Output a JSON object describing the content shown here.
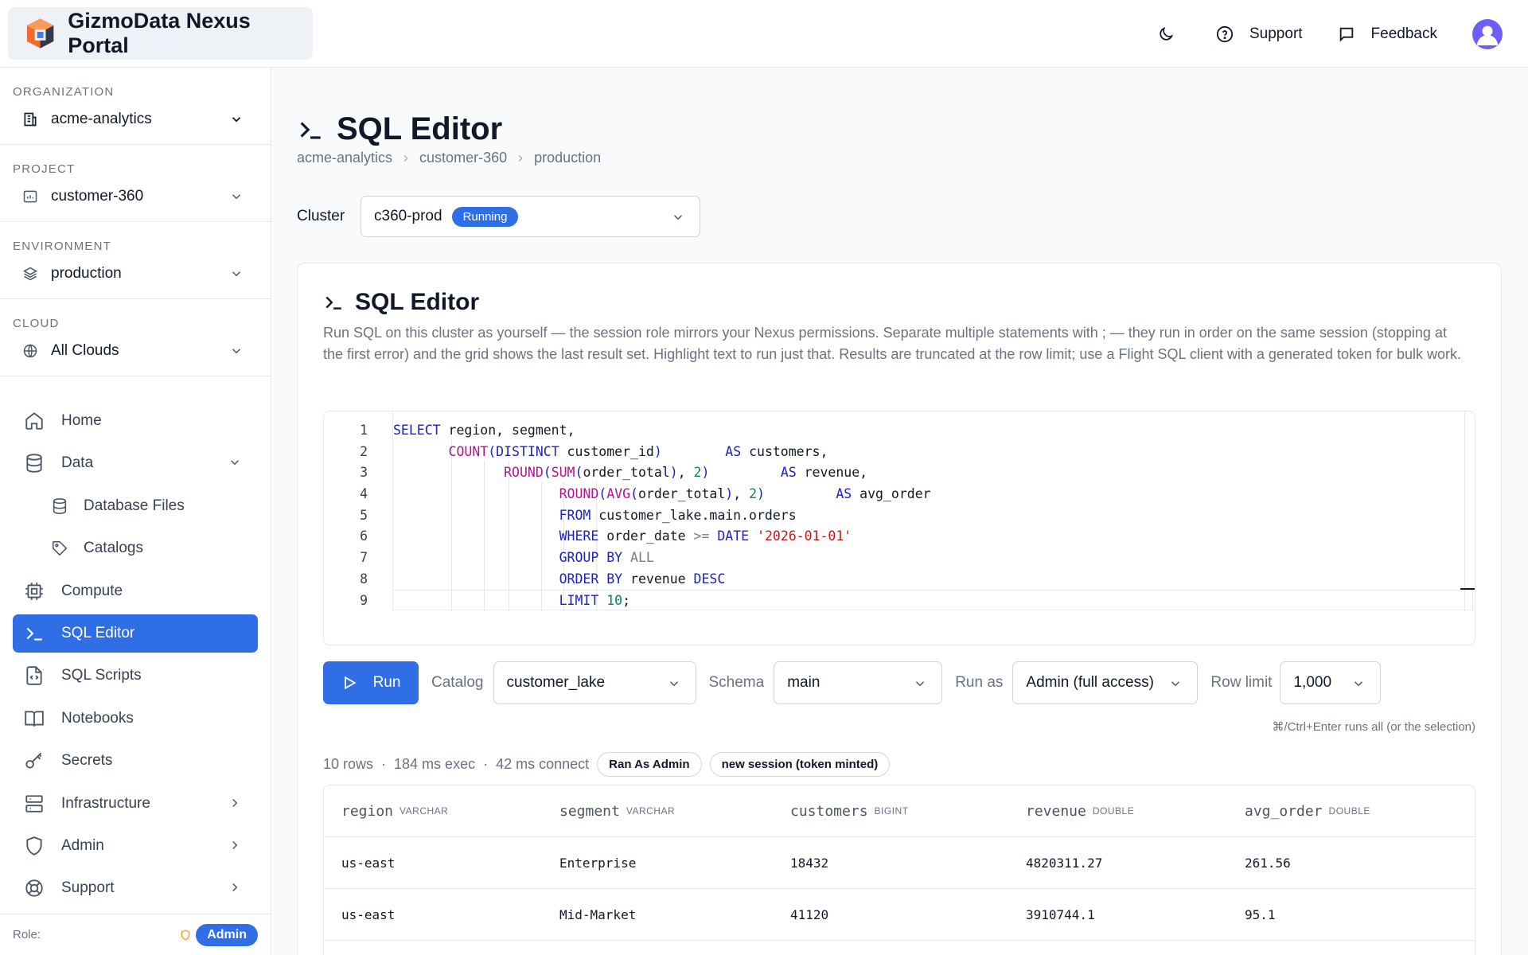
{
  "app": {
    "title": "GizmoData Nexus Portal",
    "support_label": "Support",
    "feedback_label": "Feedback"
  },
  "sidebar": {
    "selectors": [
      {
        "label": "ORGANIZATION",
        "value": "acme-analytics",
        "icon": "building-icon"
      },
      {
        "label": "PROJECT",
        "value": "customer-360",
        "icon": "folder-chart-icon"
      },
      {
        "label": "ENVIRONMENT",
        "value": "production",
        "icon": "layers-icon"
      },
      {
        "label": "CLOUD",
        "value": "All Clouds",
        "icon": "globe-icon"
      }
    ],
    "nav": [
      {
        "label": "Home",
        "icon": "home-icon"
      },
      {
        "label": "Data",
        "icon": "database-icon",
        "expanded": true
      },
      {
        "label": "Database Files",
        "icon": "database-icon",
        "sub": true
      },
      {
        "label": "Catalogs",
        "icon": "tag-icon",
        "sub": true
      },
      {
        "label": "Compute",
        "icon": "cpu-icon"
      },
      {
        "label": "SQL Editor",
        "icon": "terminal-icon",
        "active": true
      },
      {
        "label": "SQL Scripts",
        "icon": "file-code-icon"
      },
      {
        "label": "Notebooks",
        "icon": "book-icon"
      },
      {
        "label": "Secrets",
        "icon": "key-icon"
      },
      {
        "label": "Infrastructure",
        "icon": "server-icon"
      },
      {
        "label": "Admin",
        "icon": "shield-icon"
      },
      {
        "label": "Support",
        "icon": "lifebuoy-icon"
      }
    ],
    "role_label": "Role:",
    "role_value": "Admin"
  },
  "page": {
    "title": "SQL Editor",
    "breadcrumb": [
      "acme-analytics",
      "customer-360",
      "production"
    ],
    "cluster_label": "Cluster",
    "cluster_value": "c360-prod",
    "cluster_status": "Running"
  },
  "editor_card": {
    "title": "SQL Editor",
    "description": "Run SQL on this cluster as yourself — the session role mirrors your Nexus permissions. Separate multiple statements with ; — they run in order on the same session (stopping at the first error) and the grid shows the last result set. Highlight text to run just that. Results are truncated at the row limit; use a Flight SQL client with a generated token for bulk work.",
    "line_numbers": [
      "1",
      "2",
      "3",
      "4",
      "5",
      "6",
      "7",
      "8",
      "9"
    ],
    "run_label": "Run",
    "catalog_label": "Catalog",
    "catalog_value": "customer_lake",
    "schema_label": "Schema",
    "schema_value": "main",
    "run_as_label": "Run as",
    "run_as_value": "Admin (full access)",
    "row_limit_label": "Row limit",
    "row_limit_value": "1,000",
    "hint": "⌘/Ctrl+Enter runs all (or the selection)"
  },
  "results": {
    "rows": "10 rows",
    "exec": "184 ms exec",
    "connect": "42 ms connect",
    "chip_role": "Ran As Admin",
    "chip_session": "new session (token minted)",
    "columns": [
      {
        "name": "region",
        "type": "VARCHAR"
      },
      {
        "name": "segment",
        "type": "VARCHAR"
      },
      {
        "name": "customers",
        "type": "BIGINT"
      },
      {
        "name": "revenue",
        "type": "DOUBLE"
      },
      {
        "name": "avg_order",
        "type": "DOUBLE"
      }
    ],
    "data": [
      [
        "us-east",
        "Enterprise",
        "18432",
        "4820311.27",
        "261.56"
      ],
      [
        "us-east",
        "Mid-Market",
        "41120",
        "3910744.1",
        "95.1"
      ]
    ]
  },
  "colors": {
    "accent": "#2f6ee5",
    "keyword": "#1d23b8",
    "function": "#b3168c",
    "string": "#c41a16",
    "number": "#09825d"
  }
}
